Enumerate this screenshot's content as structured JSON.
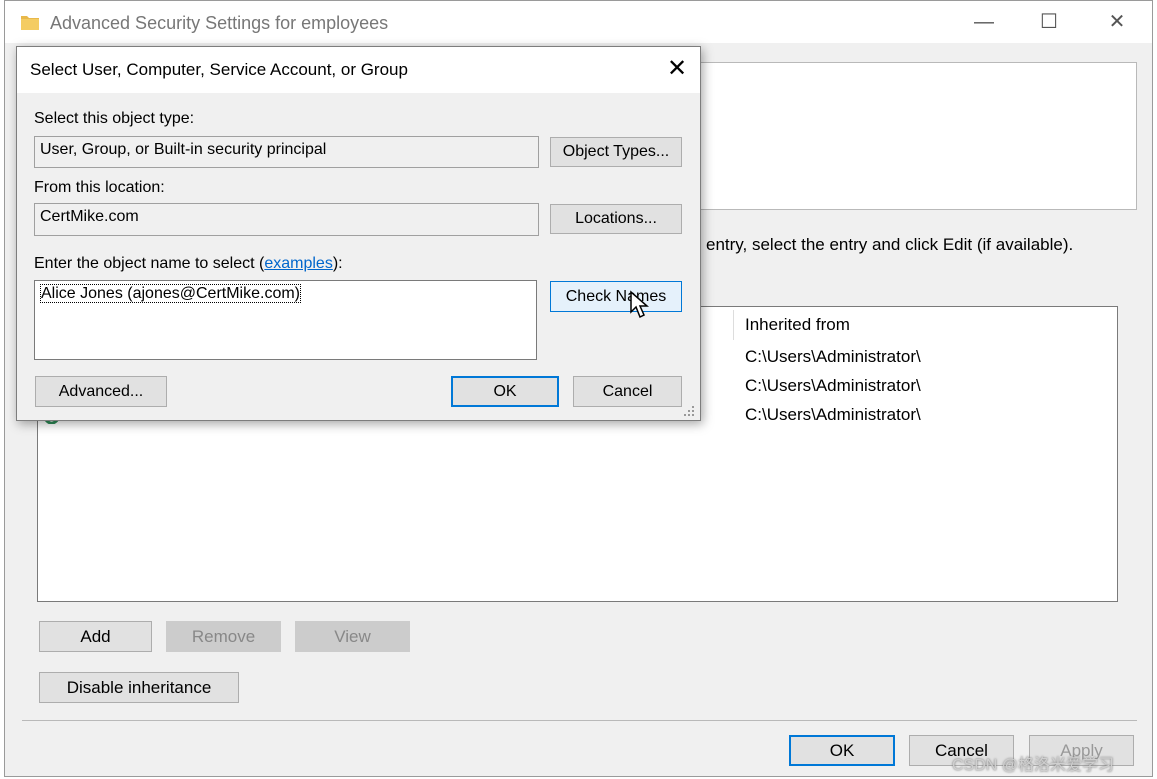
{
  "main_window": {
    "title": "Advanced Security Settings for employees",
    "instruction": "entry, select the entry and click Edit (if available).",
    "inherited_from_header": "Inherited from",
    "inherited_rows": [
      "C:\\Users\\Administrator\\",
      "C:\\Users\\Administrator\\",
      "C:\\Users\\Administrator\\"
    ],
    "buttons": {
      "add": "Add",
      "remove": "Remove",
      "view": "View",
      "disable_inheritance": "Disable inheritance",
      "ok": "OK",
      "cancel": "Cancel",
      "apply": "Apply"
    },
    "controls": {
      "minimize": "—",
      "maximize": "☐",
      "close": "✕"
    }
  },
  "dialog": {
    "title": "Select User, Computer, Service Account, or Group",
    "close": "✕",
    "object_type_label": "Select this object type:",
    "object_type_value": "User, Group, or Built-in security principal",
    "object_types_button": "Object Types...",
    "location_label": "From this location:",
    "location_value": "CertMike.com",
    "locations_button": "Locations...",
    "object_name_label_prefix": "Enter the object name to select (",
    "object_name_label_link": "examples",
    "object_name_label_suffix": "):",
    "object_name_value": "Alice Jones (ajones@CertMike.com)",
    "check_names_button": "Check Names",
    "advanced_button": "Advanced...",
    "ok_button": "OK",
    "cancel_button": "Cancel"
  },
  "watermark": "CSDN @格洛米爱学习",
  "colors": {
    "accent": "#0078d7",
    "link": "#0066cc",
    "folder": "#e8b84a"
  },
  "icons": [
    "folder-icon",
    "cursor-icon",
    "resize-grip-icon",
    "user-icon"
  ]
}
